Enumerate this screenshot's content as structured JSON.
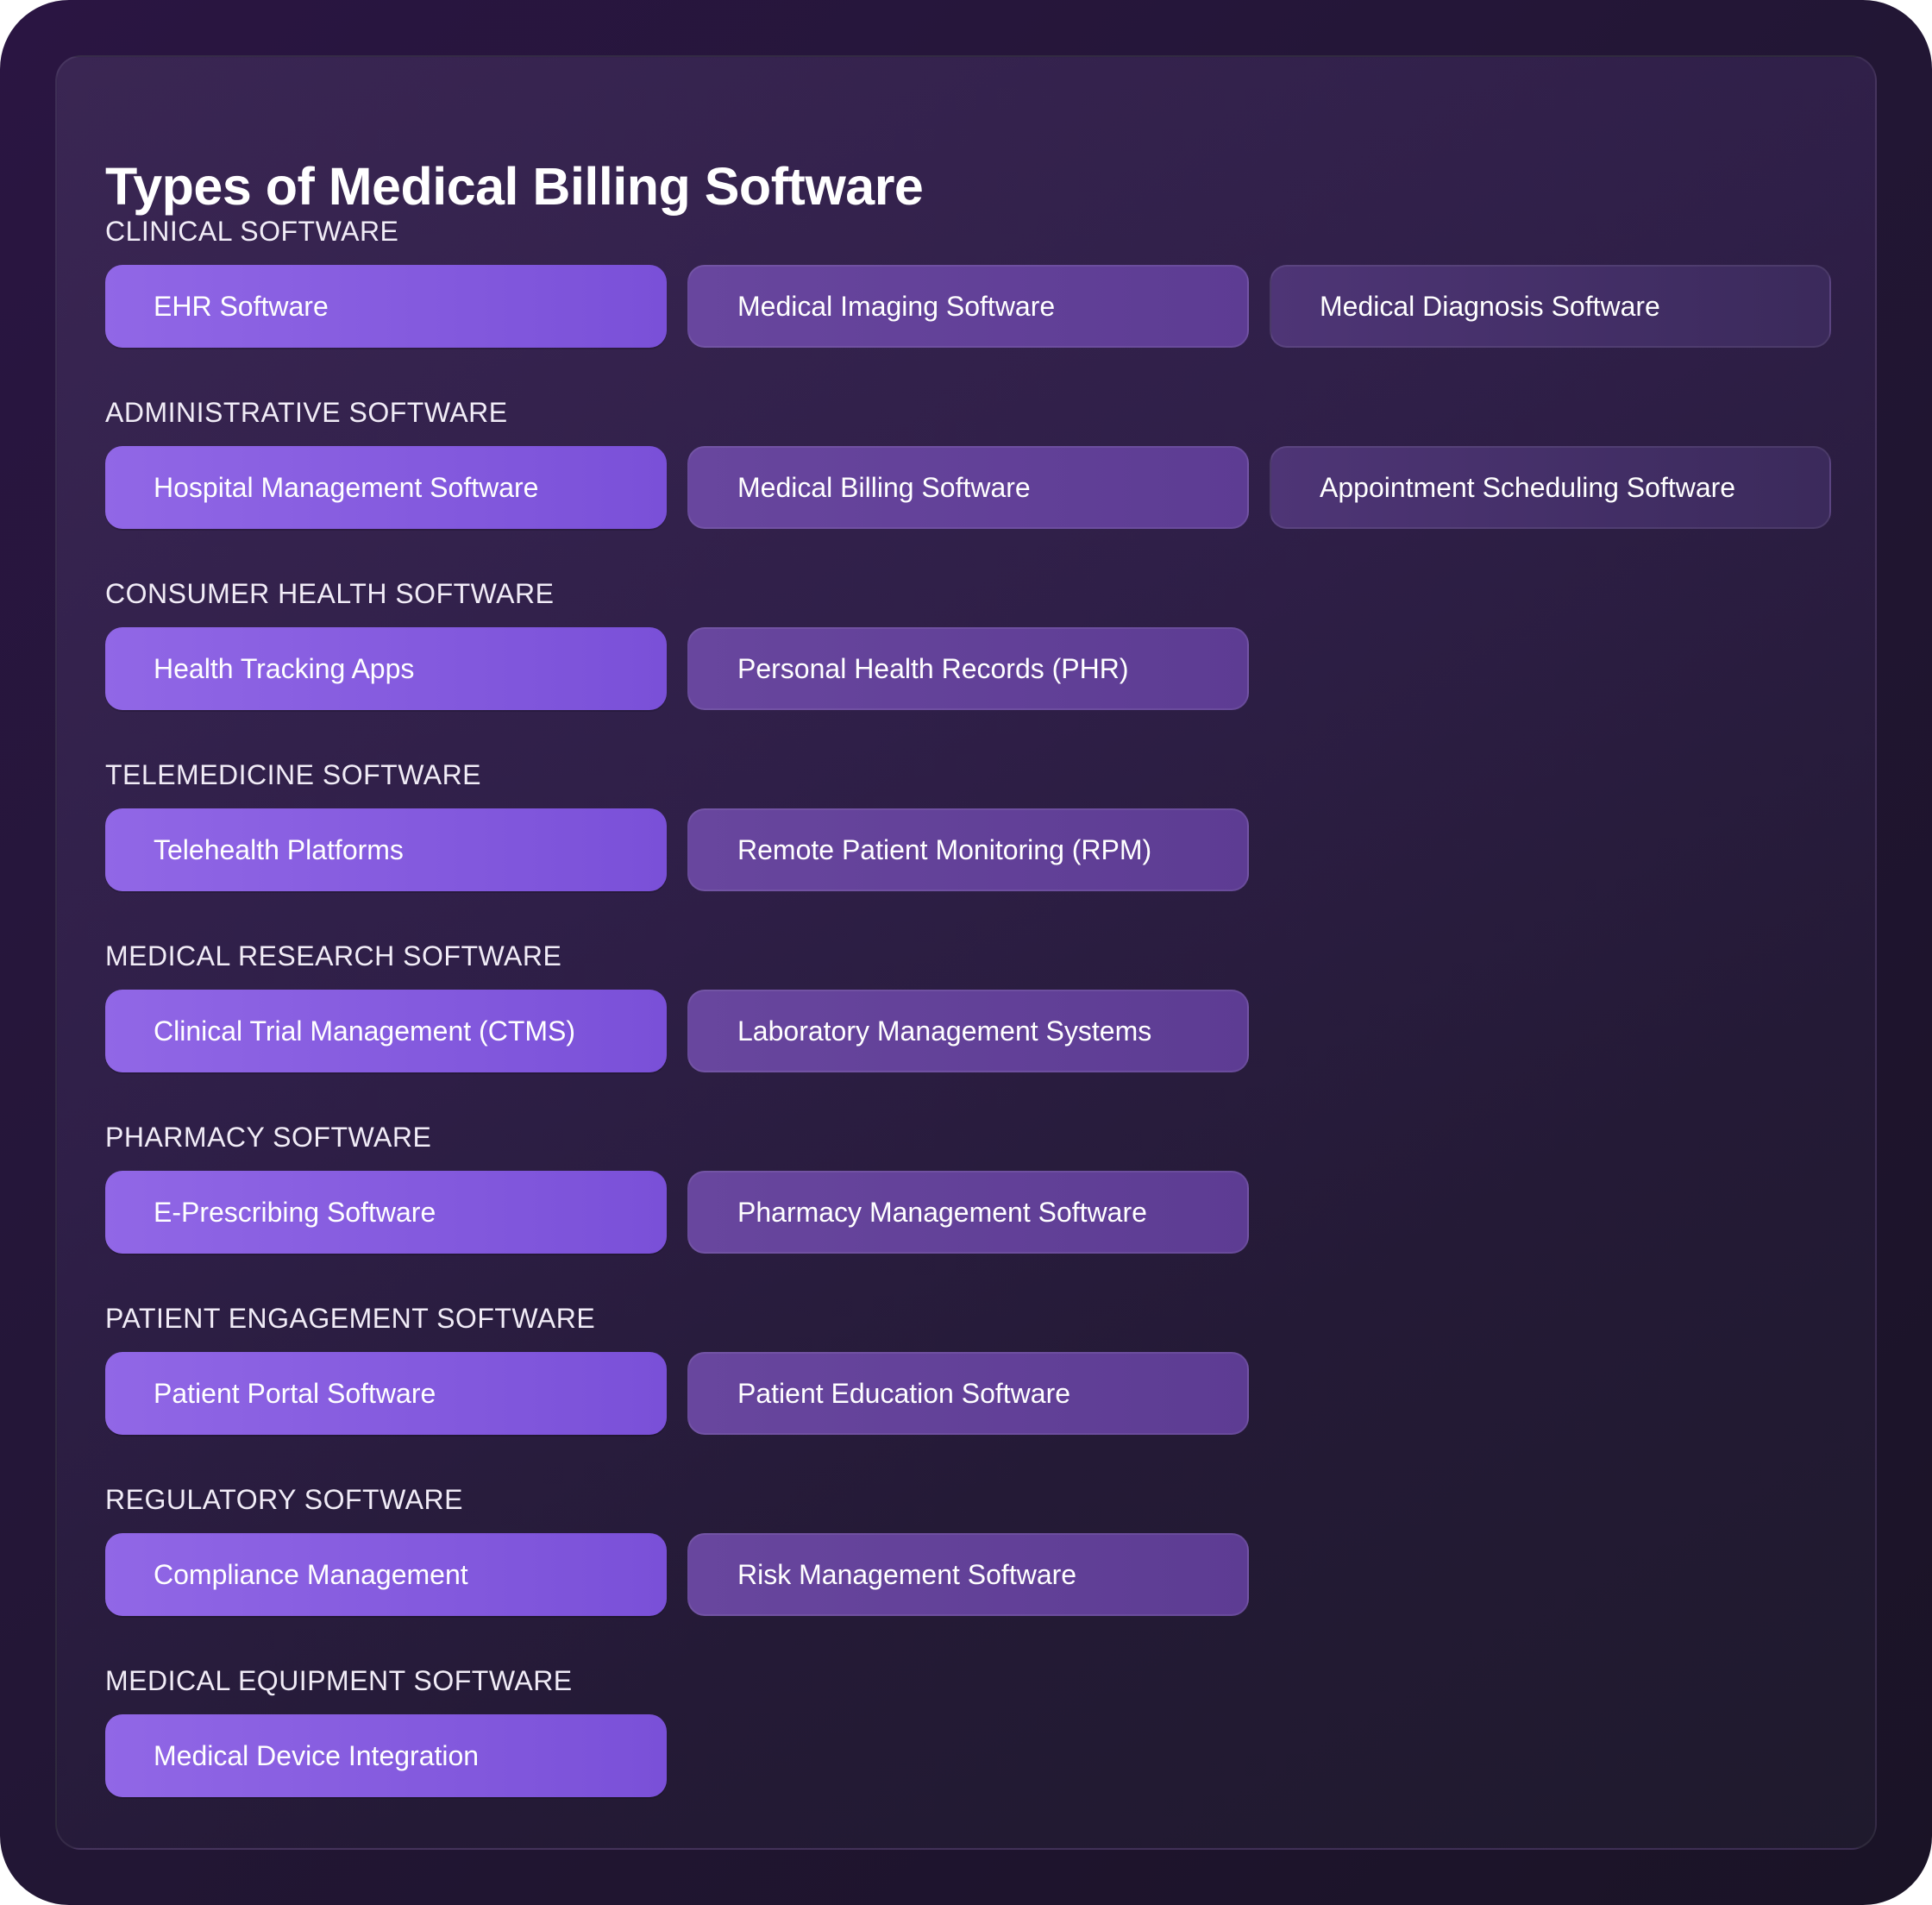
{
  "title": "Types of Medical Billing Software",
  "sections": [
    {
      "label": "CLINICAL SOFTWARE",
      "items": [
        "EHR Software",
        "Medical Imaging Software",
        "Medical Diagnosis Software"
      ]
    },
    {
      "label": "ADMINISTRATIVE SOFTWARE",
      "items": [
        "Hospital Management Software",
        "Medical Billing Software",
        "Appointment Scheduling Software"
      ]
    },
    {
      "label": "CONSUMER HEALTH SOFTWARE",
      "items": [
        "Health Tracking Apps",
        "Personal Health Records (PHR)"
      ]
    },
    {
      "label": "TELEMEDICINE SOFTWARE",
      "items": [
        "Telehealth Platforms",
        "Remote Patient Monitoring (RPM)"
      ]
    },
    {
      "label": "MEDICAL RESEARCH SOFTWARE",
      "items": [
        "Clinical Trial Management (CTMS)",
        "Laboratory Management Systems"
      ]
    },
    {
      "label": "PHARMACY SOFTWARE",
      "items": [
        "E-Prescribing Software",
        "Pharmacy Management Software"
      ]
    },
    {
      "label": "PATIENT ENGAGEMENT SOFTWARE",
      "items": [
        "Patient Portal Software",
        "Patient Education Software"
      ]
    },
    {
      "label": "REGULATORY SOFTWARE",
      "items": [
        "Compliance Management",
        "Risk Management Software"
      ]
    },
    {
      "label": "MEDICAL EQUIPMENT SOFTWARE",
      "items": [
        "Medical Device Integration"
      ]
    }
  ]
}
